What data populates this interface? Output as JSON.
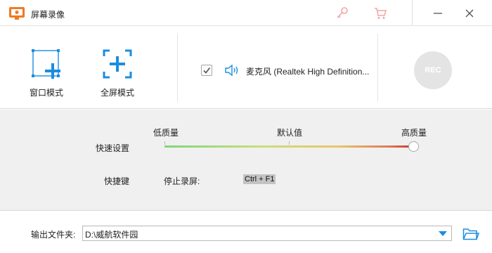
{
  "titlebar": {
    "title": "屏幕录像",
    "icons": [
      "app-logo-icon",
      "key-icon",
      "cart-icon",
      "minimize-icon",
      "close-icon"
    ]
  },
  "modes": [
    {
      "label": "窗口模式",
      "icon": "window-mode-icon"
    },
    {
      "label": "全屏模式",
      "icon": "fullscreen-mode-icon"
    }
  ],
  "audio": {
    "checked": true,
    "mic_label": "麦克风 (Realtek High Definition..."
  },
  "rec_button": {
    "label": "REC"
  },
  "quality": {
    "section_label": "快速设置",
    "low": "低质量",
    "default": "默认值",
    "high": "高质量",
    "value": 1.0
  },
  "hotkey": {
    "section_label": "快捷键",
    "stop_label": "停止录屏:",
    "stop_key": "Ctrl + F1"
  },
  "output": {
    "label": "输出文件夹:",
    "path": "D:\\威航软件园"
  },
  "colors": {
    "accent": "#1a8de0",
    "app_icon": "#f07a22",
    "rec_disabled": "#e4e4e4"
  }
}
